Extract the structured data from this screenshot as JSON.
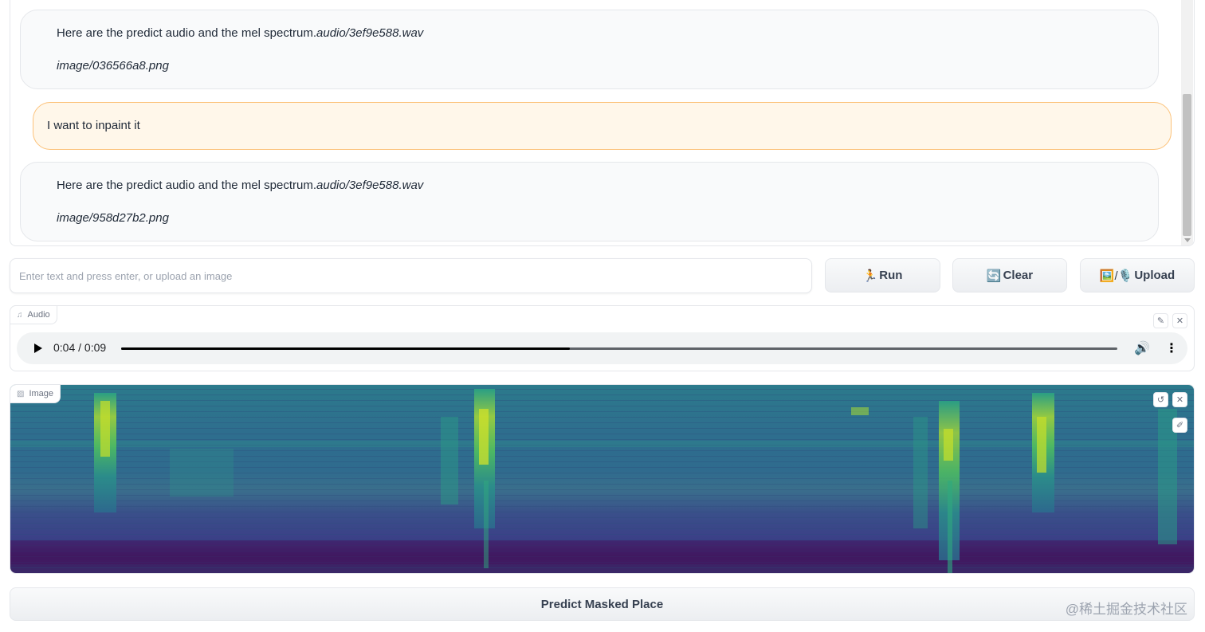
{
  "chat": {
    "messages": [
      {
        "role": "bot",
        "text": "Here are the predict audio and the mel spectrum.",
        "audio_path": "audio/3ef9e588.wav",
        "image_path": "image/036566a8.png"
      },
      {
        "role": "user",
        "text": "I want to inpaint it"
      },
      {
        "role": "bot",
        "text": "Here are the predict audio and the mel spectrum.",
        "audio_path": "audio/3ef9e588.wav",
        "image_path": "image/958d27b2.png"
      }
    ]
  },
  "input": {
    "placeholder": "Enter text and press enter, or upload an image",
    "value": ""
  },
  "buttons": {
    "run": {
      "icon": "🏃",
      "label": "Run"
    },
    "clear": {
      "icon": "🔄",
      "label": "Clear"
    },
    "upload": {
      "icon": "🖼️/🎙️",
      "label": " Upload"
    }
  },
  "audio": {
    "label": "Audio",
    "label_icon": "♫",
    "time": "0:04 / 0:09",
    "progress": 0.45
  },
  "image": {
    "label": "Image",
    "label_icon": "▨"
  },
  "predict": {
    "label": "Predict Masked Place"
  },
  "watermark": "@稀土掘金技术社区",
  "icons": {
    "edit": "✎",
    "close": "✕",
    "undo": "↺",
    "brush": "✐",
    "volume": "🔊",
    "more": "⋮"
  }
}
